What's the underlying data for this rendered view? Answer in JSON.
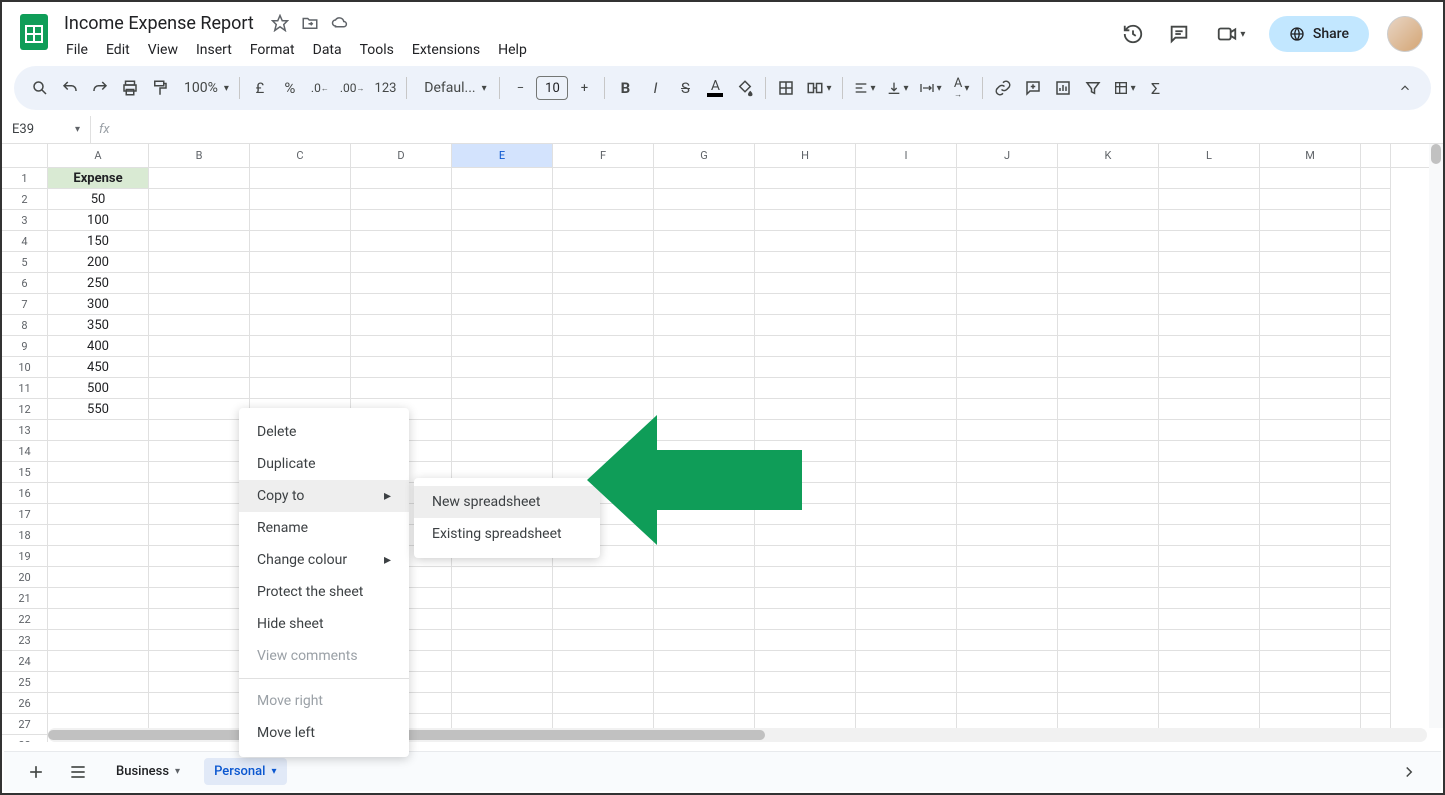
{
  "doc": {
    "title": "Income Expense Report"
  },
  "menu": {
    "file": "File",
    "edit": "Edit",
    "view": "View",
    "insert": "Insert",
    "format": "Format",
    "data": "Data",
    "tools": "Tools",
    "extensions": "Extensions",
    "help": "Help"
  },
  "share": {
    "label": "Share"
  },
  "toolbar": {
    "zoom": "100%",
    "currency": "£",
    "percent": "%",
    "fmt123": "123",
    "font": "Defaul...",
    "fontsize": "10"
  },
  "namebox": {
    "ref": "E39"
  },
  "columns": [
    "A",
    "B",
    "C",
    "D",
    "E",
    "F",
    "G",
    "H",
    "I",
    "J",
    "K",
    "L",
    "M"
  ],
  "selected_col": "E",
  "sheet": {
    "header": "Expense",
    "rows": [
      "50",
      "100",
      "150",
      "200",
      "250",
      "300",
      "350",
      "400",
      "450",
      "500",
      "550"
    ]
  },
  "context_menu": {
    "delete": "Delete",
    "duplicate": "Duplicate",
    "copy_to": "Copy to",
    "rename": "Rename",
    "change_colour": "Change colour",
    "protect": "Protect the sheet",
    "hide": "Hide sheet",
    "view_comments": "View comments",
    "move_right": "Move right",
    "move_left": "Move left"
  },
  "submenu": {
    "new_spreadsheet": "New spreadsheet",
    "existing_spreadsheet": "Existing spreadsheet"
  },
  "tabs": {
    "business": "Business",
    "personal": "Personal"
  },
  "colors": {
    "accent": "#0b57d0",
    "arrow": "#0f9d58"
  }
}
